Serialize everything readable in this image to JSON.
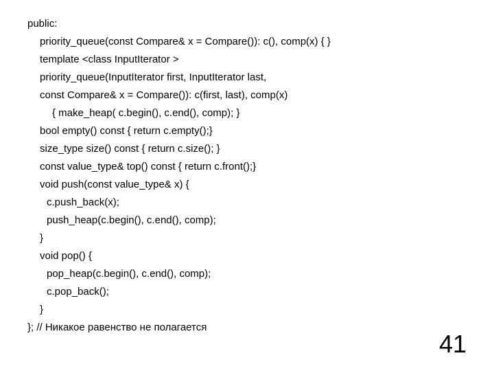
{
  "code": {
    "line1": "public:",
    "line2": "priority_queue(const Compare& x = Compare()): c(), comp(x) { }",
    "line3": "template <class InputIterator >",
    "line4": "priority_queue(InputIterator first, InputIterator last,",
    "line5": "const Compare& x = Compare()): c(first, last), comp(x)",
    "line6": "{ make_heap( c.begin(), c.end(), comp); }",
    "line7": "bool empty() const { return c.empty();}",
    "line8": "size_type size() const { return c.size(); }",
    "line9": "const value_type& top() const { return c.front();}",
    "line10": "void push(const value_type& x) {",
    "line11": "c.push_back(x);",
    "line12": "push_heap(c.begin(), c.end(), comp);",
    "line13": "}",
    "line14": "void pop() {",
    "line15": "pop_heap(c.begin(), c.end(), comp);",
    "line16": "c.pop_back();",
    "line17": "}",
    "line18": "}; // Никакое равенство не полагается"
  },
  "page_number": "41"
}
